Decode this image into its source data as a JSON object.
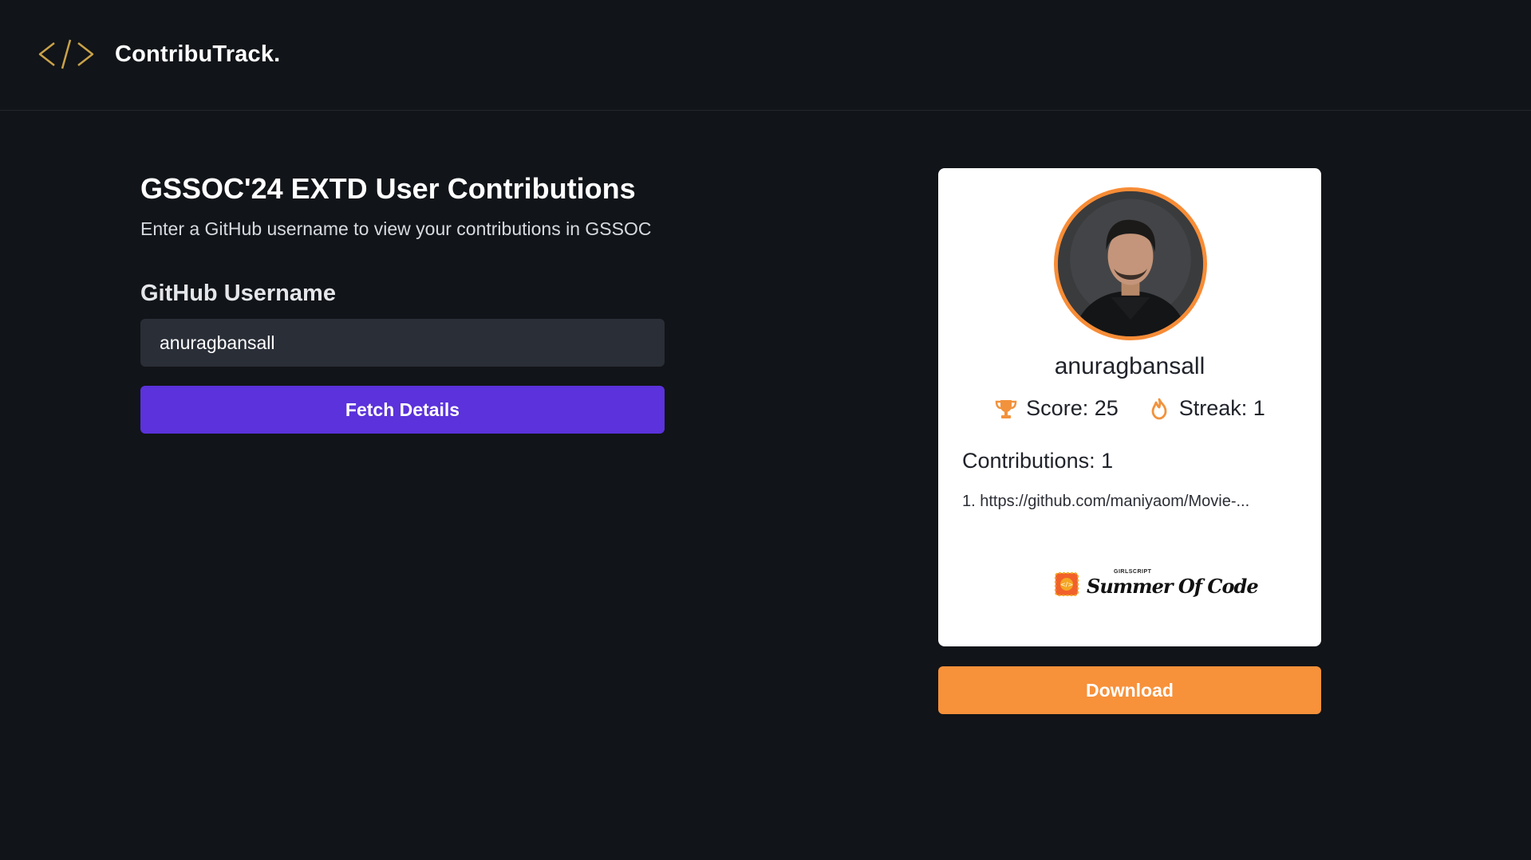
{
  "navbar": {
    "brand_name": "ContribuTrack.",
    "brand_icon": "code-brackets-icon",
    "brand_icon_color": "#c9a24a"
  },
  "form": {
    "title": "GSSOC'24 EXTD User Contributions",
    "subtitle": "Enter a GitHub username to view your contributions in GSSOC",
    "field_label": "GitHub Username",
    "username_value": "anuragbansall",
    "fetch_button_label": "Fetch Details"
  },
  "card": {
    "username": "anuragbansall",
    "score_label": "Score: 25",
    "streak_label": "Streak: 1",
    "contributions_heading": "Contributions: 1",
    "contributions": [
      "1. https://github.com/maniyaom/Movie-..."
    ],
    "logo": {
      "small_text": "GIRLSCRIPT",
      "script_text": "Summer Of Code"
    }
  },
  "download_button_label": "Download",
  "colors": {
    "background": "#111418",
    "primary_button": "#5b32db",
    "accent_orange": "#f7913a",
    "input_bg": "#2a2e37"
  }
}
